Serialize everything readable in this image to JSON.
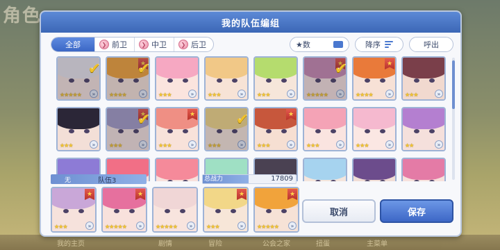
{
  "background": {
    "title_fragment": "角色",
    "bottom_menu": [
      "我的主页",
      "剧情",
      "冒险",
      "公会之家",
      "扭蛋",
      "主菜单"
    ]
  },
  "dialog": {
    "title": "我的队伍编组"
  },
  "toolbar": {
    "tabs": [
      {
        "label": "全部",
        "active": true
      },
      {
        "label": "前卫",
        "active": false
      },
      {
        "label": "中卫",
        "active": false
      },
      {
        "label": "后卫",
        "active": false
      }
    ],
    "sort_stat_label": "★数",
    "sort_order_label": "降序",
    "unlist_label": "呼出"
  },
  "grid": {
    "rows": [
      [
        {
          "stars": "★★★★★",
          "fav": false,
          "selected": true,
          "hair": "#e9e4ea",
          "skin": "#f6e3dc"
        },
        {
          "stars": "★★★★",
          "fav": true,
          "selected": true,
          "hair": "#f1a33b",
          "skin": "#f6e2d6"
        },
        {
          "stars": "★★★",
          "fav": false,
          "selected": false,
          "hair": "#f6a8c2",
          "skin": "#fbe4de"
        },
        {
          "stars": "★★★",
          "fav": false,
          "selected": false,
          "hair": "#f1c887",
          "skin": "#f7e3d6"
        },
        {
          "stars": "★★★",
          "fav": false,
          "selected": false,
          "hair": "#b5dc6e",
          "skin": "#f6e6da"
        },
        {
          "stars": "★★★★★",
          "fav": true,
          "selected": true,
          "hair": "#c98ab0",
          "skin": "#f6e0dc"
        },
        {
          "stars": "★★★★",
          "fav": true,
          "selected": false,
          "hair": "#e97a3a",
          "skin": "#f7e1d6"
        },
        {
          "stars": "★★★",
          "fav": false,
          "selected": false,
          "hair": "#7a3f4a",
          "skin": "#f1d9cf"
        }
      ],
      [
        {
          "stars": "★★★",
          "fav": false,
          "selected": false,
          "hair": "#2b2637",
          "skin": "#f3dfd7"
        },
        {
          "stars": "★★★",
          "fav": true,
          "selected": true,
          "hair": "#a59cc6",
          "skin": "#f5e2dc"
        },
        {
          "stars": "★★★",
          "fav": true,
          "selected": false,
          "hair": "#ef8f84",
          "skin": "#f8e2da"
        },
        {
          "stars": "★★★",
          "fav": false,
          "selected": true,
          "hair": "#f2d788",
          "skin": "#f7e6d8"
        },
        {
          "stars": "★★★",
          "fav": true,
          "selected": false,
          "hair": "#c7573c",
          "skin": "#f6dfd2"
        },
        {
          "stars": "★★★",
          "fav": false,
          "selected": false,
          "hair": "#f4a3b6",
          "skin": "#fae4e0"
        },
        {
          "stars": "★★★",
          "fav": false,
          "selected": false,
          "hair": "#f5b9cf",
          "skin": "#fbe7e3"
        },
        {
          "stars": "★★",
          "fav": false,
          "selected": false,
          "hair": "#b47fd0",
          "skin": "#f5e0dc"
        }
      ],
      [
        {
          "stars": "",
          "fav": false,
          "selected": false,
          "hair": "#8d7bd6",
          "skin": "#f3e1dc"
        },
        {
          "stars": "",
          "fav": false,
          "selected": false,
          "hair": "#f16f86",
          "skin": "#f8e1dc"
        },
        {
          "stars": "",
          "fav": false,
          "selected": false,
          "hair": "#f58a9a",
          "skin": "#f8e1dc"
        },
        {
          "stars": "",
          "fav": false,
          "selected": false,
          "hair": "#9fe0c4",
          "skin": "#f4e6dc"
        },
        {
          "stars": "",
          "fav": false,
          "selected": false,
          "hair": "#4a4152",
          "skin": "#f1ddd5"
        },
        {
          "stars": "",
          "fav": false,
          "selected": false,
          "hair": "#a6d3ef",
          "skin": "#f4e5dc"
        },
        {
          "stars": "",
          "fav": false,
          "selected": false,
          "hair": "#6c4c8c",
          "skin": "#f1ddd5"
        },
        {
          "stars": "",
          "fav": false,
          "selected": false,
          "hair": "#e47ba6",
          "skin": "#f7e1dc"
        }
      ]
    ]
  },
  "party": {
    "none_label": "无",
    "name": "队伍3",
    "power_label": "总战力",
    "power_value": "17809",
    "members": [
      {
        "stars": "★★★",
        "fav": true,
        "hair": "#c9a7d8",
        "skin": "#f6e2dc"
      },
      {
        "stars": "★★★★★",
        "fav": true,
        "hair": "#e6709e",
        "skin": "#f8e1dc"
      },
      {
        "stars": "★★★★★",
        "fav": false,
        "hair": "#f0d6d6",
        "skin": "#f8e4de"
      },
      {
        "stars": "★★★",
        "fav": true,
        "hair": "#f2d788",
        "skin": "#f7e6d8"
      },
      {
        "stars": "★★★★★",
        "fav": true,
        "hair": "#f1a33b",
        "skin": "#f6e2d6"
      }
    ]
  },
  "buttons": {
    "cancel_label": "取消",
    "save_label": "保存"
  },
  "colors": {
    "header_blue": "#3c67b6",
    "check_gold": "#f0c12b",
    "star_gold": "#f4c531",
    "save_blue": "#3d67c6"
  }
}
